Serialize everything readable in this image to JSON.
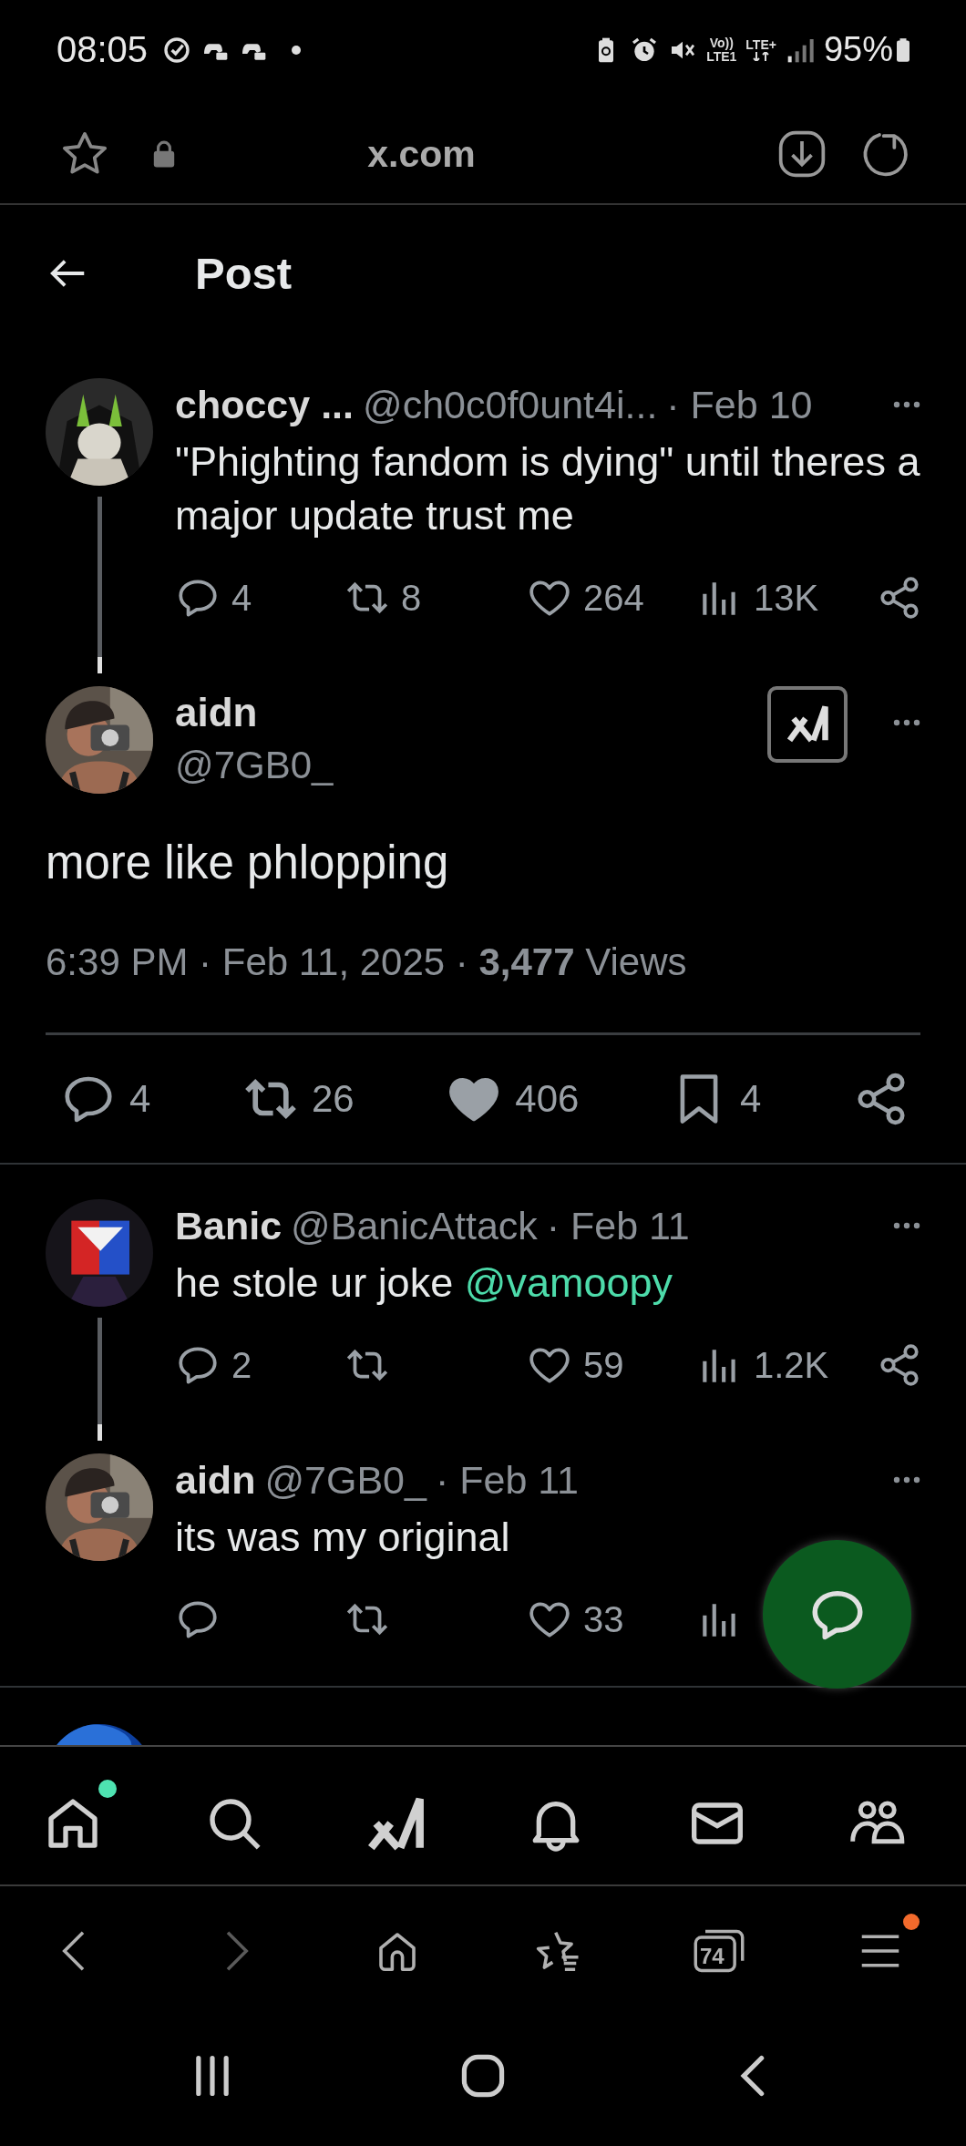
{
  "status_bar": {
    "time": "08:05",
    "volte": "Vo))",
    "sim": "LTE1",
    "network": "LTE+",
    "battery": "95%"
  },
  "browser_bar": {
    "url": "x.com"
  },
  "header": {
    "title": "Post"
  },
  "thread": [
    {
      "kind": "reply",
      "name": "choccy ...",
      "handle": "@ch0c0f0unt4i...",
      "date": "· Feb 10",
      "text": "\"Phighting fandom is dying\" until theres a major update trust me",
      "thread_line": true,
      "share_visible": true,
      "stats": {
        "replies": "4",
        "reposts": "8",
        "likes": "264",
        "views": "13K"
      },
      "reposted": false,
      "liked": false
    },
    {
      "kind": "focus",
      "name": "aidn",
      "handle": "@7GB0_",
      "text": "more like phlopping",
      "meta": "6:39 PM · Feb 11, 2025 · **3,477** Views",
      "stats": {
        "replies": "4",
        "reposts": "26",
        "likes": "406",
        "bookmarks": "4"
      },
      "reposted": true,
      "liked": true
    },
    {
      "kind": "reply",
      "name": "Banic",
      "handle": "@BanicAttack",
      "date": "· Feb 11",
      "text": "he stole ur joke",
      "mention": "@vamoopy",
      "thread_line": true,
      "share_visible": true,
      "stats": {
        "replies": "2",
        "likes": "59",
        "views": "1.2K"
      },
      "reposted": false,
      "liked": false
    },
    {
      "kind": "reply",
      "name": "aidn",
      "handle": "@7GB0_",
      "date": "· Feb 11",
      "text": "its was my original",
      "thread_line": false,
      "share_visible": false,
      "stats": {
        "likes": "33"
      },
      "reposted": false,
      "liked": false
    }
  ],
  "bottom_nav": [
    {
      "kind": "home",
      "badge": true
    },
    {
      "kind": "search",
      "badge": false
    },
    {
      "kind": "grok",
      "badge": false
    },
    {
      "kind": "notifications",
      "badge": false
    },
    {
      "kind": "messages",
      "badge": false
    },
    {
      "kind": "communities",
      "badge": false
    }
  ],
  "browser_nav": [
    {
      "kind": "back",
      "disabled": false,
      "badge": false
    },
    {
      "kind": "forward",
      "disabled": true,
      "badge": false
    },
    {
      "kind": "home",
      "disabled": false,
      "badge": false
    },
    {
      "kind": "bookmarks",
      "disabled": false,
      "badge": false
    },
    {
      "kind": "tabs",
      "count": "74",
      "disabled": false,
      "badge": false
    },
    {
      "kind": "menu",
      "disabled": false,
      "badge": true
    }
  ],
  "system_nav": [
    {
      "kind": "recents"
    },
    {
      "kind": "home"
    },
    {
      "kind": "back"
    }
  ]
}
